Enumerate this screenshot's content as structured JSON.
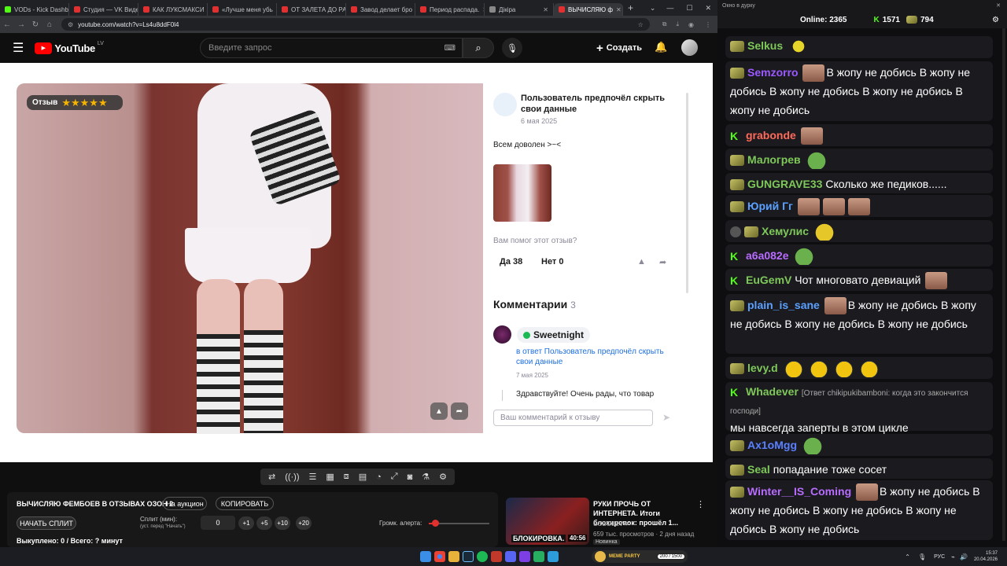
{
  "browser": {
    "tabs": [
      {
        "label": "VODs - Kick Dashb",
        "color": "#53fc18"
      },
      {
        "label": "Студия — VK Видео",
        "color": "#e03030"
      },
      {
        "label": "КАК ЛУКСМАКСИ",
        "color": "#e03030"
      },
      {
        "label": "«Лучше меня убь",
        "color": "#e03030"
      },
      {
        "label": "ОТ ЗАЛЕТА ДО РА",
        "color": "#e03030"
      },
      {
        "label": "Завод делает бро",
        "color": "#e03030"
      },
      {
        "label": "Период распада.",
        "color": "#e03030"
      },
      {
        "label": "Дiкiра",
        "color": "#888888"
      },
      {
        "label": "ВЫЧИСЛЯЮ ф",
        "color": "#e03030"
      }
    ],
    "url": "youtube.com/watch?v=Ls4u8ddF0l4"
  },
  "youtube": {
    "logo": "YouTube",
    "region": "LV",
    "search_placeholder": "Введите запрос",
    "create_label": "Создать"
  },
  "review": {
    "badge_label": "Отзыв",
    "stars": "★★★★★",
    "author": "Пользователь предпочёл скрыть свои данные",
    "date": "6 мая 2025",
    "text": "Всем доволен >~<",
    "helpful_question": "Вам помог этот отзыв?",
    "yes": "Да 38",
    "no": "Нет 0",
    "comments_title": "Комментарии",
    "comments_count": "3",
    "reply_author": "Sweetnight",
    "reply_to": "в ответ Пользователь предпочёл скрыть свои данные",
    "reply_date": "7 мая 2025",
    "reply_text": "Здравствуйте! Очень рады, что товар",
    "comment_placeholder": "Ваш комментарий к отзыву"
  },
  "panel": {
    "title": "ВЫЧИСЛЯЮ ФЕМБОЕВ В ОТЗЫВАХ ОЗОН 2",
    "auction_btn": "На аукцион",
    "copy_btn": "КОПИРОВАТЬ",
    "start_split_btn": "НАЧАТЬ СПЛИТ",
    "split_label": "Сплит (мин):",
    "split_hint": "(уст. перед \"Начать\")",
    "split_value": "0",
    "increments": [
      "+1",
      "+5",
      "+10",
      "+20"
    ],
    "volume_label": "Громк. алерта:",
    "volume_level_percent": 10,
    "bought": "Выкуплено: 0 / Всего: ? минут"
  },
  "recommended": {
    "title": "РУКИ ПРОЧЬ ОТ ИНТЕРНЕТА. Итоги блокировок: прошёл 1...",
    "channel": "SOBOLEV",
    "meta": "659 тыс. просмотров · 2 дня назад",
    "badge": "Новинка",
    "thumb_text": "БЛОКИРОВКА.",
    "duration": "40:56"
  },
  "taskbar": {
    "lang": "РУС",
    "time": "15:37",
    "date": "20.04.2026",
    "meme_party": "MEME PARTY",
    "meme_counter": "200 / 1500"
  },
  "chat": {
    "window_title": "Окно в дурку",
    "online_label": "Online:",
    "online_value": "2365",
    "kick_count": "1571",
    "badge_count": "794",
    "messages": [
      {
        "user": "Selkus",
        "color": "#7ec85a",
        "text": ""
      },
      {
        "user": "Semzorro",
        "color": "#9b59ff",
        "text": "В жопу не добись В жопу не добись В жопу не добись В жопу не добись В жопу не добись"
      },
      {
        "user": "grabonde",
        "color": "#ff6a5a",
        "text": ""
      },
      {
        "user": "Малогрев",
        "color": "#7ec85a",
        "text": ""
      },
      {
        "user": "GUNGRAVE33",
        "color": "#7ec85a",
        "text": "Сколько же педиков......"
      },
      {
        "user": "Юрий Гг",
        "color": "#5aa0ff",
        "text": ""
      },
      {
        "user": "Хемулис",
        "color": "#7ec85a",
        "text": ""
      },
      {
        "user": "a6a082e",
        "color": "#b86cff",
        "text": ""
      },
      {
        "user": "EuGemV",
        "color": "#7ec85a",
        "text": "Чот многовато девиаций"
      },
      {
        "user": "plain_is_sane",
        "color": "#5aa0ff",
        "text": "В жопу не добись В жопу не добись В жопу не добись В жопу не добись"
      },
      {
        "user": "levy.d",
        "color": "#7ec85a",
        "text": ""
      },
      {
        "user": "Whadever",
        "color": "#7ec85a",
        "reply": "[Ответ chikipukibamboni: когда это закончится господи]",
        "text": "мы навсегда заперты в этом цикле"
      },
      {
        "user": "Ax1oMgg",
        "color": "#5a80ff",
        "text": ""
      },
      {
        "user": "Seal",
        "color": "#7ec85a",
        "text": "попадание тоже сосет"
      },
      {
        "user": "Winter__IS_Coming",
        "color": "#b86cff",
        "text": "В жопу не добись В жопу не добись В жопу не добись В жопу не добись В жопу не добись"
      }
    ]
  }
}
